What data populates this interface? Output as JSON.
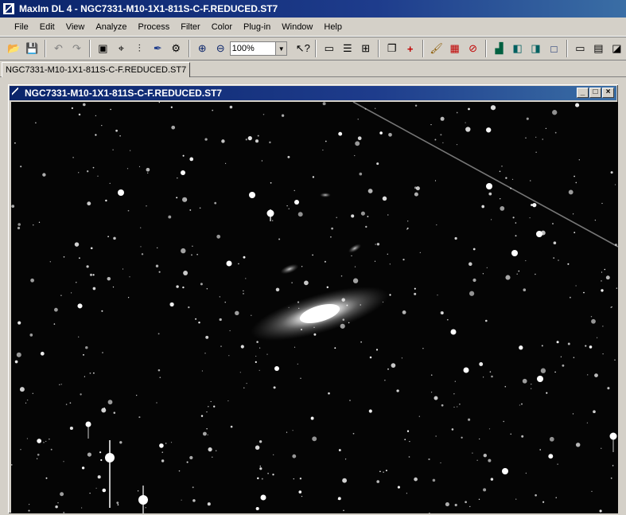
{
  "app": {
    "title": "MaxIm DL 4 - NGC7331-M10-1X1-811S-C-F.REDUCED.ST7"
  },
  "menu": [
    "File",
    "Edit",
    "View",
    "Analyze",
    "Process",
    "Filter",
    "Color",
    "Plug-in",
    "Window",
    "Help"
  ],
  "toolbar": {
    "zoom_value": "100%"
  },
  "tab": {
    "label": "NGC7331-M10-1X1-811S-C-F.REDUCED.ST7"
  },
  "image_window": {
    "title": "NGC7331-M10-1X1-811S-C-F.REDUCED.ST7"
  },
  "icons": [
    "open-icon",
    "save-icon",
    "undo-icon",
    "redo-icon",
    "image-icon",
    "crosshair-icon",
    "align-icon",
    "pick-icon",
    "settings-icon",
    "zoom-in-icon",
    "zoom-out-icon",
    "help-pointer-icon",
    "ruler-icon",
    "stack-icon",
    "calibrate-icon",
    "copy-icon",
    "crosshair-plus-icon",
    "brush-icon",
    "grid-icon",
    "no-icon",
    "histogram-icon",
    "blink-icon",
    "swap-icon",
    "square-icon",
    "window1-icon",
    "window2-icon",
    "window3-icon"
  ]
}
